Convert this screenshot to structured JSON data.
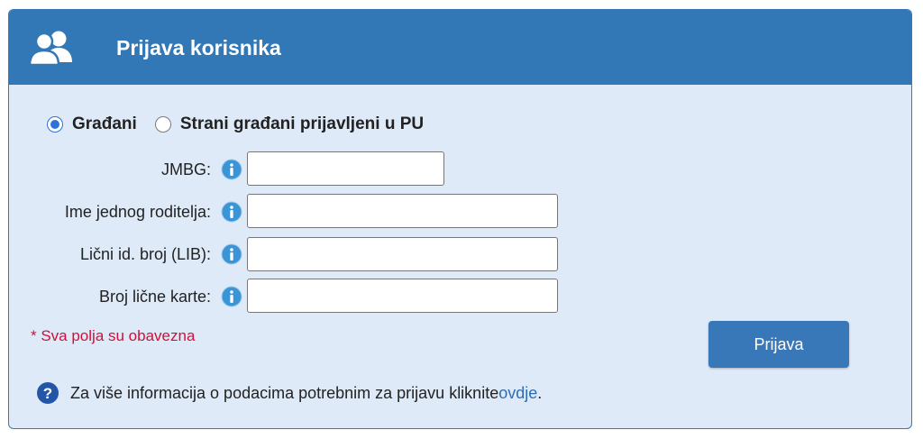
{
  "header": {
    "title": "Prijava korisnika",
    "icon": "users-icon"
  },
  "user_type": {
    "options": [
      {
        "label": "Građani",
        "checked": true
      },
      {
        "label": "Strani građani prijavljeni u PU",
        "checked": false
      }
    ]
  },
  "fields": {
    "jmbg": {
      "label": "JMBG:",
      "value": ""
    },
    "parent_name": {
      "label": "Ime jednog roditelja:",
      "value": ""
    },
    "lib": {
      "label": "Lični id. broj (LIB):",
      "value": ""
    },
    "id_card": {
      "label": "Broj lične karte:",
      "value": ""
    }
  },
  "required_note": "* Sva polja su obavezna",
  "submit_label": "Prijava",
  "help": {
    "text": "Za više informacija o podacima potrebnim za prijavu kliknite ",
    "link_label": "ovdje",
    "suffix": "."
  },
  "colors": {
    "header_bg": "#3378b6",
    "panel_bg": "#deeaf8",
    "button_bg": "#3878b8",
    "required_text": "#d0103a",
    "link": "#2d6db0"
  }
}
